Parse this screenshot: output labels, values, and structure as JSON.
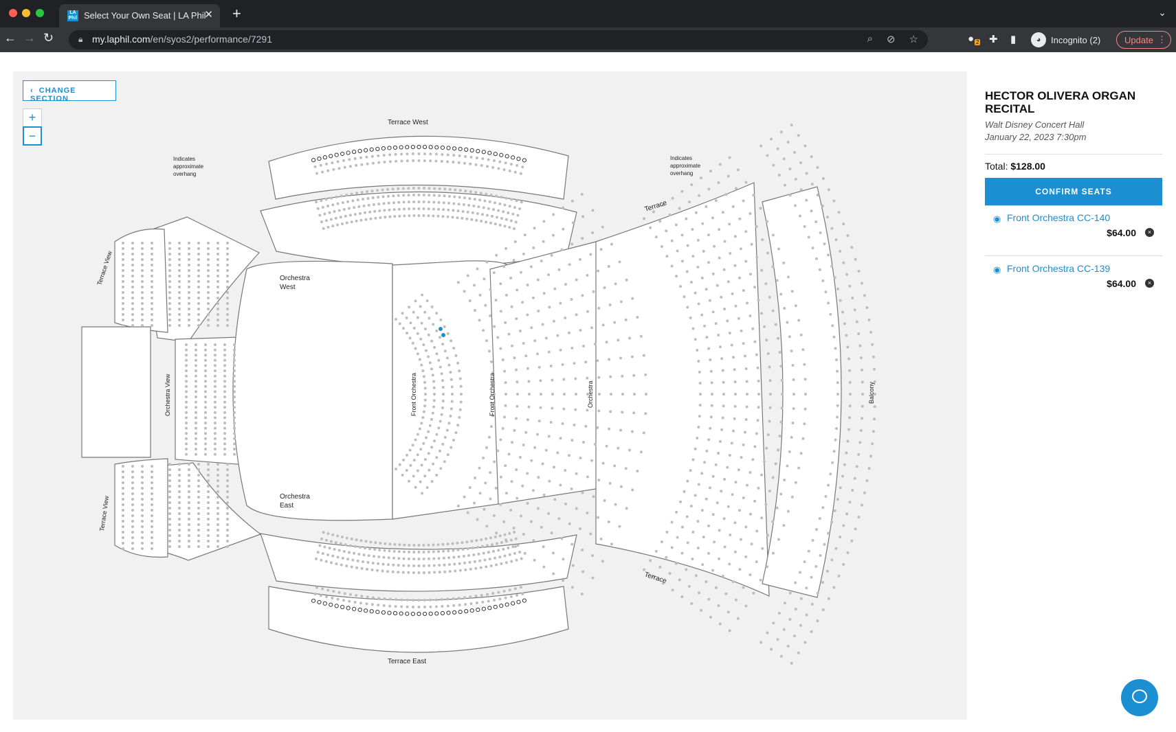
{
  "browser": {
    "tab_title": "Select Your Own Seat | LA Phil",
    "url_domain": "my.laphil.com",
    "url_path": "/en/syos2/performance/7291",
    "incognito_label": "Incognito (2)",
    "update_label": "Update",
    "extension_badge": "2",
    "favicon_text": "LA Phil"
  },
  "map": {
    "change_section_label": "CHANGE SECTION",
    "zoom_in_label": "+",
    "zoom_out_label": "−",
    "labels": {
      "terrace_west": "Terrace West",
      "overhang_note_line1": "Indicates",
      "overhang_note_line2": "approximate",
      "overhang_note_line3": "overhang",
      "terrace": "Terrace",
      "terrace_view": "Terrace View",
      "orchestra_west_1": "Orchestra",
      "orchestra_west_2": "West",
      "orchestra_east_1": "Orchestra",
      "orchestra_east_2": "East",
      "orchestra_view": "Orchestra View",
      "front_orchestra": "Front Orchestra",
      "orchestra": "Orchestra",
      "balcony": "Balcony",
      "terrace_east": "Terrace East"
    }
  },
  "event": {
    "title": "HECTOR OLIVERA ORGAN RECITAL",
    "venue": "Walt Disney Concert Hall",
    "date": "January 22, 2023 7:30pm",
    "total_label": "Total:",
    "total_value": "$128.00",
    "confirm_label": "CONFIRM SEATS"
  },
  "selected_seats": [
    {
      "label": "Front Orchestra CC-140",
      "price": "$64.00"
    },
    {
      "label": "Front Orchestra CC-139",
      "price": "$64.00"
    }
  ],
  "colors": {
    "accent": "#1b8fd2",
    "map_bg": "#f1f1f1",
    "seat": "#bdbdbd"
  }
}
